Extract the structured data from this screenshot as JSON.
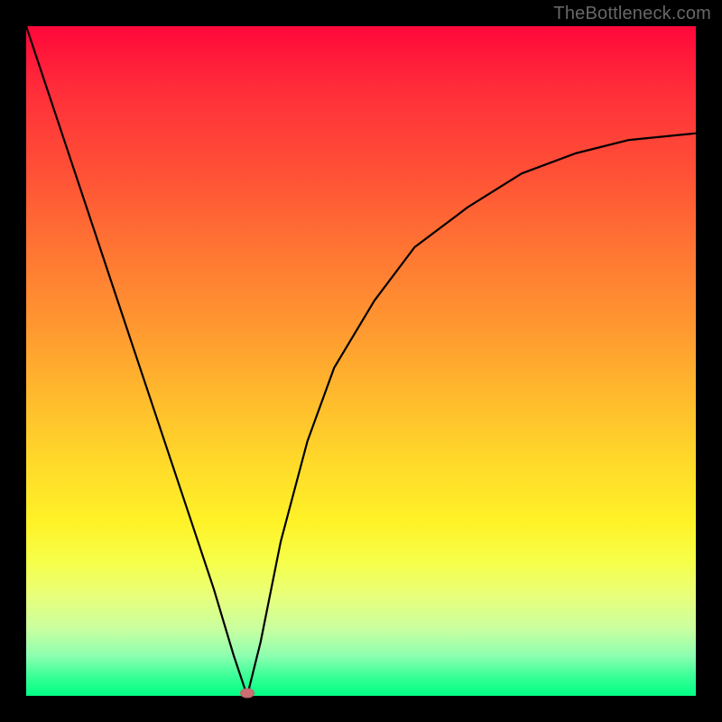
{
  "watermark": "TheBottleneck.com",
  "chart_data": {
    "type": "line",
    "title": "",
    "xlabel": "",
    "ylabel": "",
    "xlim": [
      0,
      1
    ],
    "ylim": [
      0,
      1
    ],
    "grid": false,
    "legend": false,
    "notch_x": 0.33,
    "series": [
      {
        "name": "bottleneck-curve",
        "x": [
          0.0,
          0.04,
          0.08,
          0.12,
          0.16,
          0.2,
          0.24,
          0.28,
          0.31,
          0.33,
          0.35,
          0.38,
          0.42,
          0.46,
          0.52,
          0.58,
          0.66,
          0.74,
          0.82,
          0.9,
          1.0
        ],
        "y": [
          1.0,
          0.88,
          0.76,
          0.64,
          0.52,
          0.4,
          0.28,
          0.16,
          0.06,
          0.0,
          0.08,
          0.23,
          0.38,
          0.49,
          0.59,
          0.67,
          0.73,
          0.78,
          0.81,
          0.83,
          0.84
        ]
      }
    ],
    "marker": {
      "x": 0.33,
      "y": 0.0,
      "color": "#cc6e72"
    },
    "colors": {
      "curve": "#000000",
      "marker": "#cc6e72"
    }
  }
}
